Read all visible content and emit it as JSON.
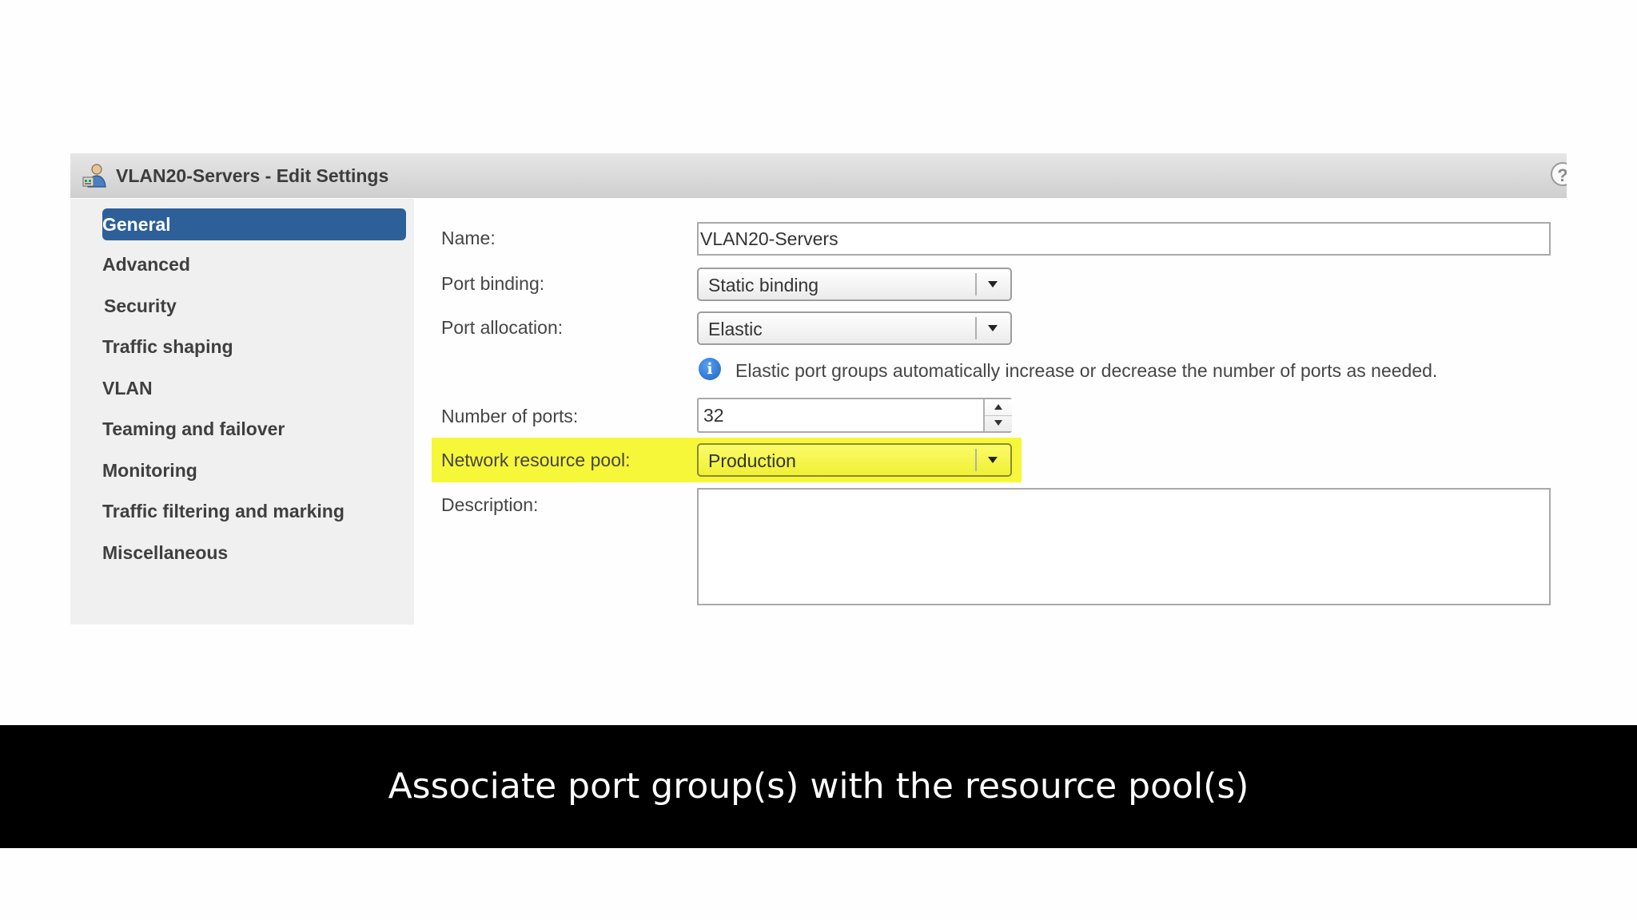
{
  "dialog": {
    "title": "VLAN20-Servers - Edit Settings",
    "help_label": "?"
  },
  "sidebar": {
    "items": [
      {
        "label": "General",
        "selected": true
      },
      {
        "label": "Advanced"
      },
      {
        "label": "Security"
      },
      {
        "label": "Traffic shaping"
      },
      {
        "label": "VLAN"
      },
      {
        "label": "Teaming and failover"
      },
      {
        "label": "Monitoring"
      },
      {
        "label": "Traffic filtering and marking"
      },
      {
        "label": "Miscellaneous"
      }
    ]
  },
  "form": {
    "name": {
      "label": "Name:",
      "value": "VLAN20-Servers"
    },
    "port_binding": {
      "label": "Port binding:",
      "value": "Static binding"
    },
    "port_allocation": {
      "label": "Port allocation:",
      "value": "Elastic"
    },
    "info": "Elastic port groups automatically increase or decrease the number of ports as needed.",
    "number_of_ports": {
      "label": "Number of ports:",
      "value": "32"
    },
    "network_resource_pool": {
      "label": "Network resource pool:",
      "value": "Production"
    },
    "description": {
      "label": "Description:",
      "value": ""
    }
  },
  "caption": "Associate port group(s) with the resource pool(s)",
  "colors": {
    "selected_nav": "#2d5f98",
    "highlight": "#f7f73a",
    "caption_bg": "#000000",
    "info_icon": "#1a63c4"
  },
  "icons": [
    "port-group-icon",
    "help-icon",
    "info-icon",
    "chevron-down-icon",
    "spinner-up-icon",
    "spinner-down-icon"
  ]
}
